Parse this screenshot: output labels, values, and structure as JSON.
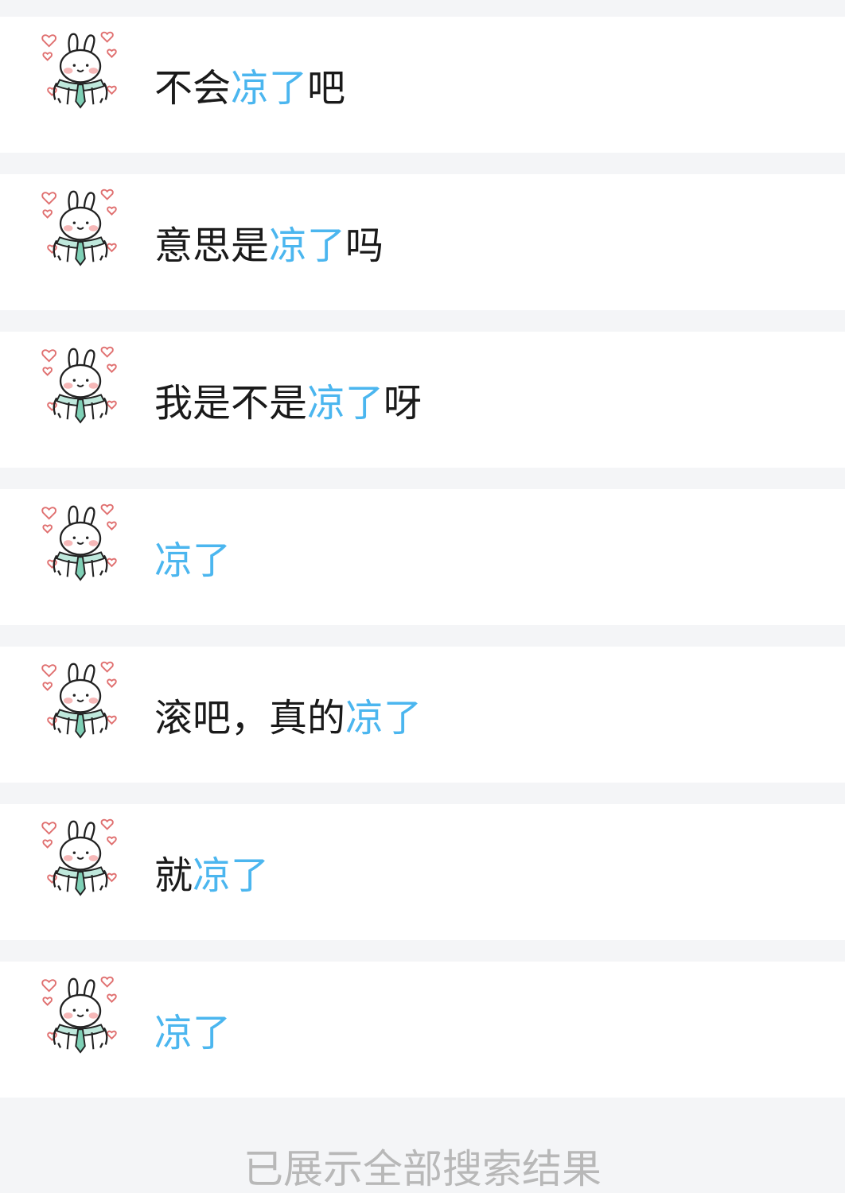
{
  "results": [
    {
      "caption": {
        "before": "不会",
        "highlight": "凉了",
        "after": "吧"
      },
      "sticker": "bunny-hearts-sticker"
    },
    {
      "caption": {
        "before": "意思是",
        "highlight": "凉了",
        "after": "吗"
      },
      "sticker": "bunny-hearts-sticker"
    },
    {
      "caption": {
        "before": "我是不是",
        "highlight": "凉了",
        "after": "呀"
      },
      "sticker": "bunny-hearts-sticker"
    },
    {
      "caption": {
        "before": "",
        "highlight": "凉了",
        "after": ""
      },
      "sticker": "bunny-hearts-sticker"
    },
    {
      "caption": {
        "before": "滚吧，真的",
        "highlight": "凉了",
        "after": ""
      },
      "sticker": "bunny-hearts-sticker"
    },
    {
      "caption": {
        "before": "就",
        "highlight": "凉了",
        "after": ""
      },
      "sticker": "bunny-hearts-sticker"
    },
    {
      "caption": {
        "before": "",
        "highlight": "凉了",
        "after": ""
      },
      "sticker": "bunny-hearts-sticker"
    }
  ],
  "footer": {
    "text": "已展示全部搜索结果"
  },
  "colors": {
    "highlight": "#4bb6ef",
    "text": "#1a1a1a",
    "separator": "#f4f5f7",
    "footer": "#b8b8b8"
  }
}
